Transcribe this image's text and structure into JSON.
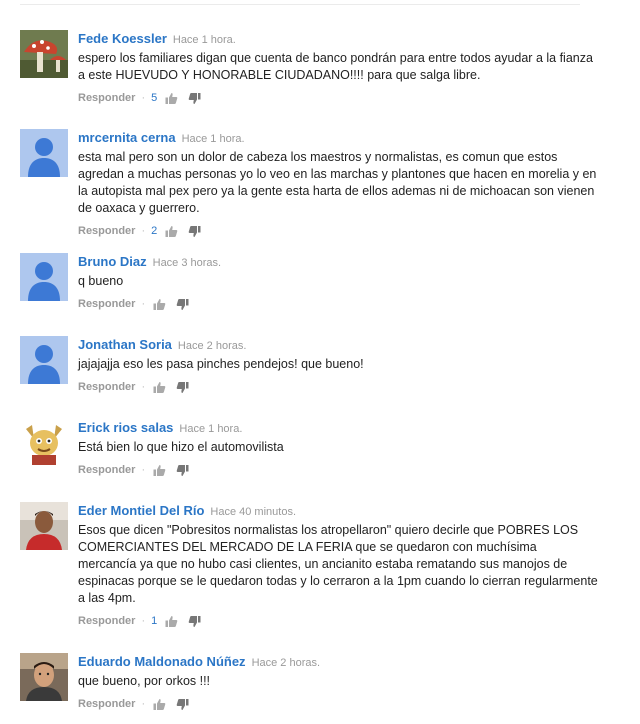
{
  "comments": [
    {
      "author": "Fede Koessler",
      "time": "Hace 1 hora.",
      "text": "espero los familiares digan que cuenta de banco pondrán para entre todos ayudar a la fianza a este HUEVUDO Y HONORABLE CIUDADANO!!!! para que salga libre.",
      "likes": "5",
      "avatar": "mushroom-photo"
    },
    {
      "author": "mrcernita cerna",
      "time": "Hace 1 hora.",
      "text": "esta mal pero son un dolor de cabeza los maestros y normalistas, es comun que estos agredan a muchas personas yo lo veo en las marchas y plantones que hacen en morelia y en la autopista mal pex pero ya la gente esta harta de ellos ademas ni de michoacan son vienen de oaxaca y guerrero.",
      "likes": "2",
      "avatar": "default-user"
    },
    {
      "author": "Bruno Diaz",
      "time": "Hace 3 horas.",
      "text": "q bueno",
      "likes": "",
      "avatar": "default-user"
    },
    {
      "author": "Jonathan Soria",
      "time": "Hace 2 horas.",
      "text": "jajajajja eso les pasa pinches pendejos! que bueno!",
      "likes": "",
      "avatar": "default-user"
    },
    {
      "author": "Erick rios salas",
      "time": "Hace 1 hora.",
      "text": "Está bien lo que hizo el automovilista",
      "likes": "",
      "avatar": "cartoon-character"
    },
    {
      "author": "Eder Montiel Del Río",
      "time": "Hace 40 minutos.",
      "text": "Esos que dicen \"Pobresitos normalistas los atropellaron\" quiero decirle que POBRES LOS COMERCIANTES DEL MERCADO DE LA FERIA que se quedaron con muchísima mercancía ya que no hubo casi clientes, un ancianito estaba rematando sus manojos de espinacas porque se le quedaron todas y lo cerraron a la 1pm cuando lo cierran regularmente a las 4pm.",
      "likes": "1",
      "avatar": "person-photo-red-shirt"
    },
    {
      "author": "Eduardo Maldonado Núñez",
      "time": "Hace 2 horas.",
      "text": "que bueno, por orkos !!!",
      "likes": "",
      "avatar": "person-photo"
    }
  ],
  "labels": {
    "reply": "Responder",
    "separator": "·"
  },
  "colors": {
    "author": "#2b76c6",
    "meta": "#999999",
    "default_avatar_bg": "#aec7ee",
    "default_avatar_fg": "#3d79d5"
  }
}
